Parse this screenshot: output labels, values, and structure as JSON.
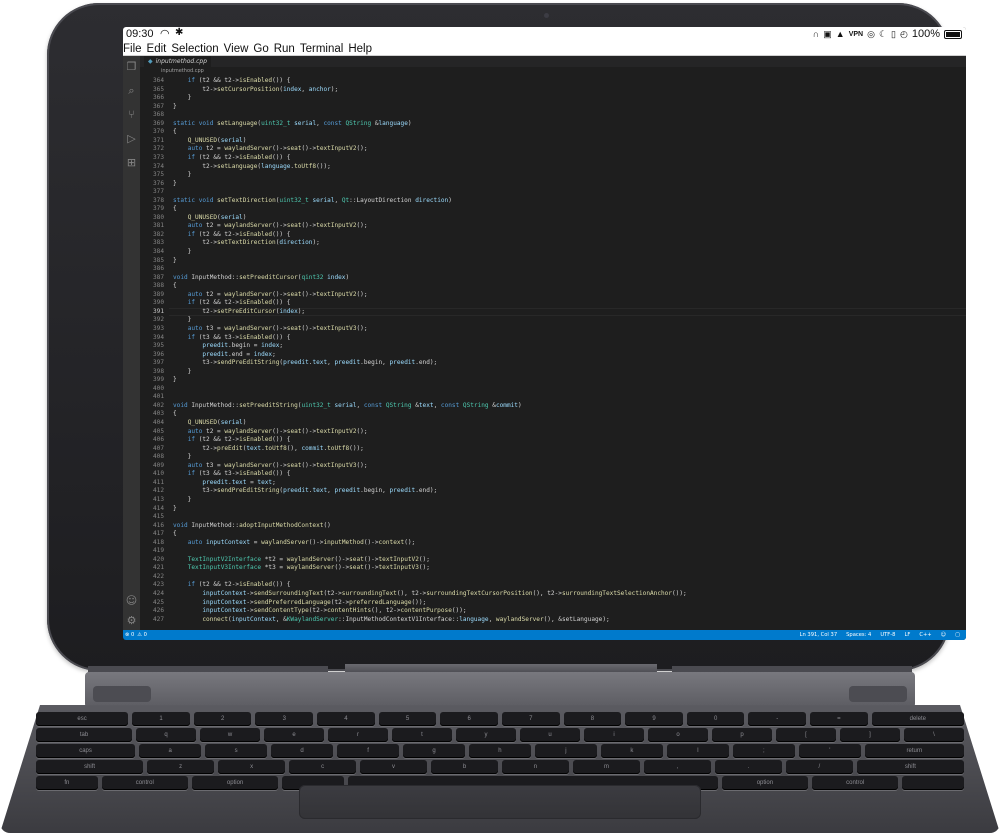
{
  "status_bar": {
    "time": "09:30",
    "vpn": "VPN",
    "battery": "100%"
  },
  "menu": [
    "File",
    "Edit",
    "Selection",
    "View",
    "Go",
    "Run",
    "Terminal",
    "Help"
  ],
  "activity_icons": [
    "files-icon",
    "search-icon",
    "source-control-icon",
    "run-debug-icon",
    "extensions-icon",
    "account-icon",
    "settings-gear-icon"
  ],
  "tab": {
    "label": "inputmethod.cpp"
  },
  "breadcrumb": "inputmethod.cpp",
  "editor": {
    "active_line": 391,
    "lines": [
      {
        "n": 364,
        "t": "    if (t2 && t2->isEnabled()) {"
      },
      {
        "n": 365,
        "t": "        t2->setCursorPosition(index, anchor);"
      },
      {
        "n": 366,
        "t": "    }"
      },
      {
        "n": 367,
        "t": "}"
      },
      {
        "n": 368,
        "t": ""
      },
      {
        "n": 369,
        "t": "static void setLanguage(uint32_t serial, const QString &language)"
      },
      {
        "n": 370,
        "t": "{"
      },
      {
        "n": 371,
        "t": "    Q_UNUSED(serial)"
      },
      {
        "n": 372,
        "t": "    auto t2 = waylandServer()->seat()->textInputV2();"
      },
      {
        "n": 373,
        "t": "    if (t2 && t2->isEnabled()) {"
      },
      {
        "n": 374,
        "t": "        t2->setLanguage(language.toUtf8());"
      },
      {
        "n": 375,
        "t": "    }"
      },
      {
        "n": 376,
        "t": "}"
      },
      {
        "n": 377,
        "t": ""
      },
      {
        "n": 378,
        "t": "static void setTextDirection(uint32_t serial, Qt::LayoutDirection direction)"
      },
      {
        "n": 379,
        "t": "{"
      },
      {
        "n": 380,
        "t": "    Q_UNUSED(serial)"
      },
      {
        "n": 381,
        "t": "    auto t2 = waylandServer()->seat()->textInputV2();"
      },
      {
        "n": 382,
        "t": "    if (t2 && t2->isEnabled()) {"
      },
      {
        "n": 383,
        "t": "        t2->setTextDirection(direction);"
      },
      {
        "n": 384,
        "t": "    }"
      },
      {
        "n": 385,
        "t": "}"
      },
      {
        "n": 386,
        "t": ""
      },
      {
        "n": 387,
        "t": "void InputMethod::setPreeditCursor(qint32 index)"
      },
      {
        "n": 388,
        "t": "{"
      },
      {
        "n": 389,
        "t": "    auto t2 = waylandServer()->seat()->textInputV2();"
      },
      {
        "n": 390,
        "t": "    if (t2 && t2->isEnabled()) {"
      },
      {
        "n": 391,
        "t": "        t2->setPreEditCursor(index);"
      },
      {
        "n": 392,
        "t": "    }"
      },
      {
        "n": 393,
        "t": "    auto t3 = waylandServer()->seat()->textInputV3();"
      },
      {
        "n": 394,
        "t": "    if (t3 && t3->isEnabled()) {"
      },
      {
        "n": 395,
        "t": "        preedit.begin = index;"
      },
      {
        "n": 396,
        "t": "        preedit.end = index;"
      },
      {
        "n": 397,
        "t": "        t3->sendPreEditString(preedit.text, preedit.begin, preedit.end);"
      },
      {
        "n": 398,
        "t": "    }"
      },
      {
        "n": 399,
        "t": "}"
      },
      {
        "n": 400,
        "t": ""
      },
      {
        "n": 401,
        "t": ""
      },
      {
        "n": 402,
        "t": "void InputMethod::setPreeditString(uint32_t serial, const QString &text, const QString &commit)"
      },
      {
        "n": 403,
        "t": "{"
      },
      {
        "n": 404,
        "t": "    Q_UNUSED(serial)"
      },
      {
        "n": 405,
        "t": "    auto t2 = waylandServer()->seat()->textInputV2();"
      },
      {
        "n": 406,
        "t": "    if (t2 && t2->isEnabled()) {"
      },
      {
        "n": 407,
        "t": "        t2->preEdit(text.toUtf8(), commit.toUtf8());"
      },
      {
        "n": 408,
        "t": "    }"
      },
      {
        "n": 409,
        "t": "    auto t3 = waylandServer()->seat()->textInputV3();"
      },
      {
        "n": 410,
        "t": "    if (t3 && t3->isEnabled()) {"
      },
      {
        "n": 411,
        "t": "        preedit.text = text;"
      },
      {
        "n": 412,
        "t": "        t3->sendPreEditString(preedit.text, preedit.begin, preedit.end);"
      },
      {
        "n": 413,
        "t": "    }"
      },
      {
        "n": 414,
        "t": "}"
      },
      {
        "n": 415,
        "t": ""
      },
      {
        "n": 416,
        "t": "void InputMethod::adoptInputMethodContext()"
      },
      {
        "n": 417,
        "t": "{"
      },
      {
        "n": 418,
        "t": "    auto inputContext = waylandServer()->inputMethod()->context();"
      },
      {
        "n": 419,
        "t": ""
      },
      {
        "n": 420,
        "t": "    TextInputV2Interface *t2 = waylandServer()->seat()->textInputV2();"
      },
      {
        "n": 421,
        "t": "    TextInputV3Interface *t3 = waylandServer()->seat()->textInputV3();"
      },
      {
        "n": 422,
        "t": ""
      },
      {
        "n": 423,
        "t": "    if (t2 && t2->isEnabled()) {"
      },
      {
        "n": 424,
        "t": "        inputContext->sendSurroundingText(t2->surroundingText(), t2->surroundingTextCursorPosition(), t2->surroundingTextSelectionAnchor());"
      },
      {
        "n": 425,
        "t": "        inputContext->sendPreferredLanguage(t2->preferredLanguage());"
      },
      {
        "n": 426,
        "t": "        inputContext->sendContentType(t2->contentHints(), t2->contentPurpose());"
      },
      {
        "n": 427,
        "t": "        connect(inputContext, &KWaylandServer::InputMethodContextV1Interface::language, waylandServer(), &setLanguage);"
      }
    ]
  },
  "statusbar": {
    "left": [
      "⊗ 0",
      "⚠ 0"
    ],
    "position": "Ln 391, Col 37",
    "spaces": "Spaces: 4",
    "encoding": "UTF-8",
    "eol": "LF",
    "language": "C++"
  },
  "keyboard": {
    "row1": [
      "esc",
      "1",
      "2",
      "3",
      "4",
      "5",
      "6",
      "7",
      "8",
      "9",
      "0",
      "-",
      "=",
      "delete"
    ],
    "row2": [
      "tab",
      "q",
      "w",
      "e",
      "r",
      "t",
      "y",
      "u",
      "i",
      "o",
      "p",
      "[",
      "]",
      "\\"
    ],
    "row3": [
      "caps",
      "a",
      "s",
      "d",
      "f",
      "g",
      "h",
      "j",
      "k",
      "l",
      ";",
      "'",
      "return"
    ],
    "row4": [
      "shift",
      "z",
      "x",
      "c",
      "v",
      "b",
      "n",
      "m",
      ",",
      ".",
      "/",
      "shift"
    ],
    "row5": [
      "fn",
      "control",
      "option",
      "",
      "",
      "option",
      "control",
      ""
    ]
  }
}
